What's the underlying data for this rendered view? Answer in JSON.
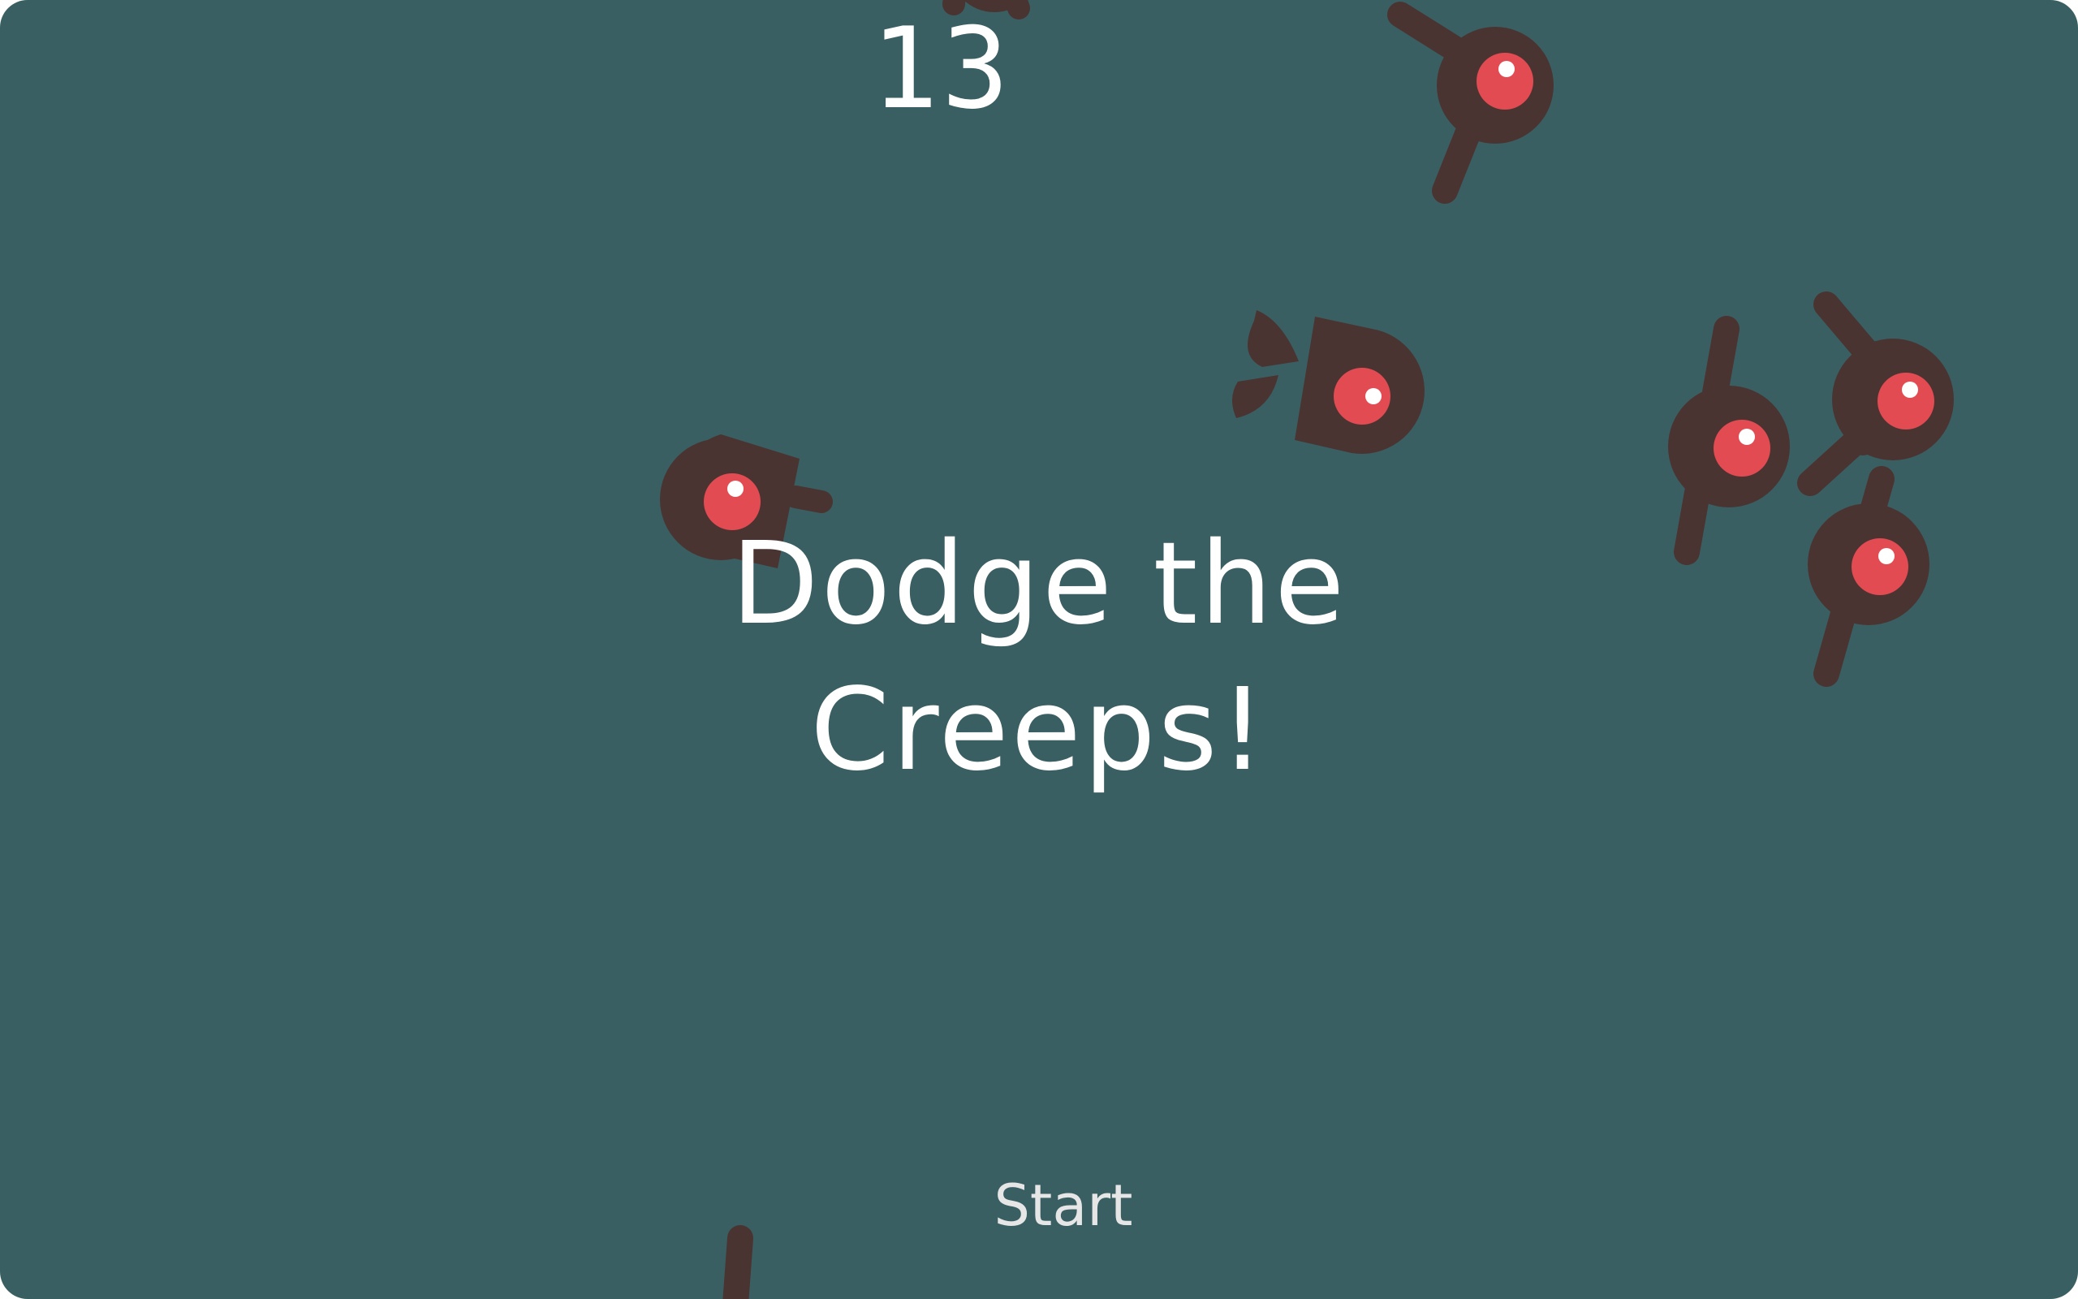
{
  "game": {
    "score": "13",
    "message_line_1": "Dodge the",
    "message_line_2": "Creeps!",
    "start_label": "Start"
  },
  "colors": {
    "background": "#3a5f62",
    "creep_body": "#4a3432",
    "creep_eye": "#e24b52",
    "eye_shine": "#ffffff",
    "text": "#ffffff"
  },
  "sprites": {
    "creep_count": 9,
    "icon": "creep-enemy-icon"
  }
}
